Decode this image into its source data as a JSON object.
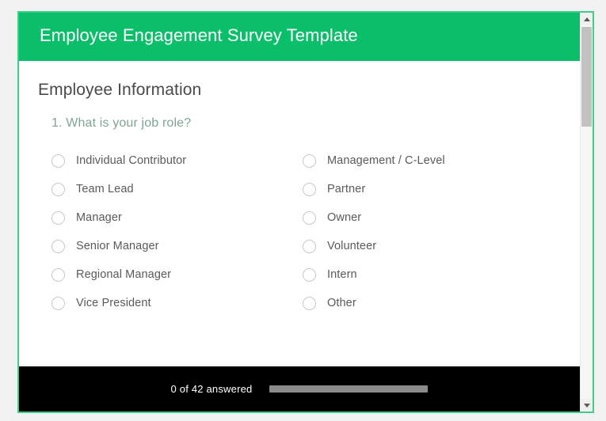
{
  "theme": {
    "accent_green": "#0bbf6a",
    "border_green": "#3fcc8c",
    "question_text_color": "#7fa593",
    "footer_background": "#000000",
    "page_background": "#f2f2f2"
  },
  "header": {
    "title": "Employee Engagement Survey Template"
  },
  "body": {
    "section_heading": "Employee Information",
    "question": {
      "number_and_text": "1. What is your job role?",
      "type": "radio-single-select",
      "selected": null,
      "columns": [
        {
          "options": [
            {
              "label": "Individual Contributor",
              "selected": false
            },
            {
              "label": "Team Lead",
              "selected": false
            },
            {
              "label": "Manager",
              "selected": false
            },
            {
              "label": "Senior Manager",
              "selected": false
            },
            {
              "label": "Regional Manager",
              "selected": false
            },
            {
              "label": "Vice President",
              "selected": false
            }
          ]
        },
        {
          "options": [
            {
              "label": "Management / C-Level",
              "selected": false
            },
            {
              "label": "Partner",
              "selected": false
            },
            {
              "label": "Owner",
              "selected": false
            },
            {
              "label": "Volunteer",
              "selected": false
            },
            {
              "label": "Intern",
              "selected": false
            },
            {
              "label": "Other",
              "selected": false
            }
          ]
        }
      ]
    }
  },
  "footer": {
    "answered_text": "0 of 42 answered",
    "answered_count": 0,
    "total_questions": 42,
    "progress_percent": 0
  },
  "scrollbar": {
    "up_arrow_icon": "triangle-up-icon",
    "down_arrow_icon": "triangle-down-icon",
    "thumb_position_percent": 4
  }
}
